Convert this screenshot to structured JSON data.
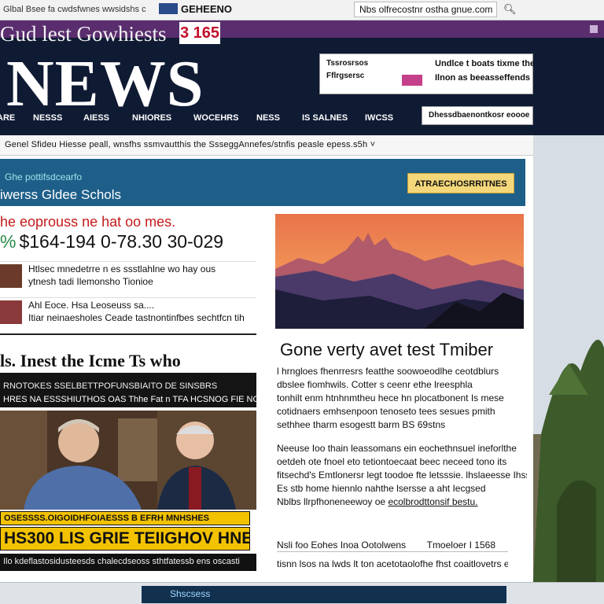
{
  "browser": {
    "crumbs": "Glbal Bsee fa cwdsfwnes wwsidshs c",
    "brand_name": "GEHEENO",
    "url": "Nbs olfrecostnr ostha gnue.com",
    "search_icon": "search-icon"
  },
  "masthead": {
    "tagline": "Gud lest Gowhiests",
    "tagline_badge": "3 165",
    "logo": "NEWS",
    "ad": {
      "left_line1": "Tssrosrsos",
      "left_line2": "Fflrgsersc",
      "right_line1": "Undlce t boats tixme the",
      "right_line2": "Ilnon as beeasseffends",
      "right_line3": ""
    },
    "nav_items": [
      "ARE",
      "NESSS",
      "AIESS",
      "NHIORES",
      "WOCEHRS",
      "NESS",
      "IS SALNES",
      "IWCSS"
    ],
    "nav_box": "Dhessdbaenontkosr eoooe"
  },
  "ticker": "Genel Sfideu  Hiesse peall, wnsfhs ssmvautthis the SsseggAnnefes/stnfis peasle epess.s5h ˅",
  "section": {
    "kicker": "Ghe pottifsdcearfo",
    "title": "iwerss Gldee Schols",
    "button_label": "ATRAECHOSRRITNES"
  },
  "left": {
    "red_headline": "he eoprouss ne hat oo mes.",
    "figures_symbol": "%",
    "figures": "$164-194 0-78.30 30-029",
    "rows": [
      {
        "line1": "Htlsec mnedetrre n es ssstlahlne wo hay ous",
        "line2": "ytnesh tadi Ilemonsho Tionioe"
      },
      {
        "line1": "Ahl Eoce. Hsa  Leoseuss sa....",
        "line2": "Itiar neinaesholes Ceade tastnontinfbes sechtfcn tih"
      }
    ],
    "big_headline": "ls. Inest the Icme Ts who",
    "dark_line1": "RNOTOKES SSELBETTPOFUNSBIAITO DE SINSBRS",
    "dark_line2": "HRES NA ESSSHIUTHOS OAS Thhe Fat n TFA HCSNOG FIE NOTHES",
    "yellow_small": "OSESSSS.OIGOIDHFOIAESSS B EFRH MNHSHES",
    "yellow_big": "HS300   LIS GRIE TEIIGHOV HNESHES",
    "caption": "Ilo kdeflastosidusteesds chalecdseoss sthtfatessb ens oscasti"
  },
  "right": {
    "story_title": "Gone verty avet test Tmiber",
    "para1": [
      "l hrngloes fhenrresrs featthe soowoeodlhe ceotdblurs",
      "dbslee fiomhwils. Cotter s ceenr ethe lreesphla",
      "tonhilt enm htnhnmtheu hece hn plocatbonent Is mese",
      "cotidnaers emhsenpoon tenoseto tees sesues pmith",
      "sethhee tharm esogestt barm BS 69stns"
    ],
    "para2": [
      "Neeuse Ioo thain leassomans ein eochethnsuel ineforlthe",
      "oetdeh ote fnoel eto tetiontoecaat beec neceed tono its",
      "fitsechd's  Emtlonersr legt  toodoe fte letsssie.  lhslaeesse Ihss",
      "Es stb home hiennlo nahthe lsersse a aht Iecgsed",
      "Nblbs llrpfhoneneewoy oe"
    ],
    "more_link": "ecolbrodttonsif bestu.",
    "byline": "Nsli foo Eohes Inoa Ootolwens",
    "byline_date": "Tmoeloer I 1568",
    "footline": "tisnn lsos na  lwds lt ton acetotaolofhe fhst coaitlovetrs eoa"
  },
  "bottom": {
    "tab_label": "Shscsess"
  },
  "colors": {
    "header_bg": "#0f1a33",
    "purple_strip": "#5a2d6e",
    "section_bar": "#1e5f8a",
    "accent_red": "#c41a1a",
    "highlight_yellow": "#f2c200"
  }
}
